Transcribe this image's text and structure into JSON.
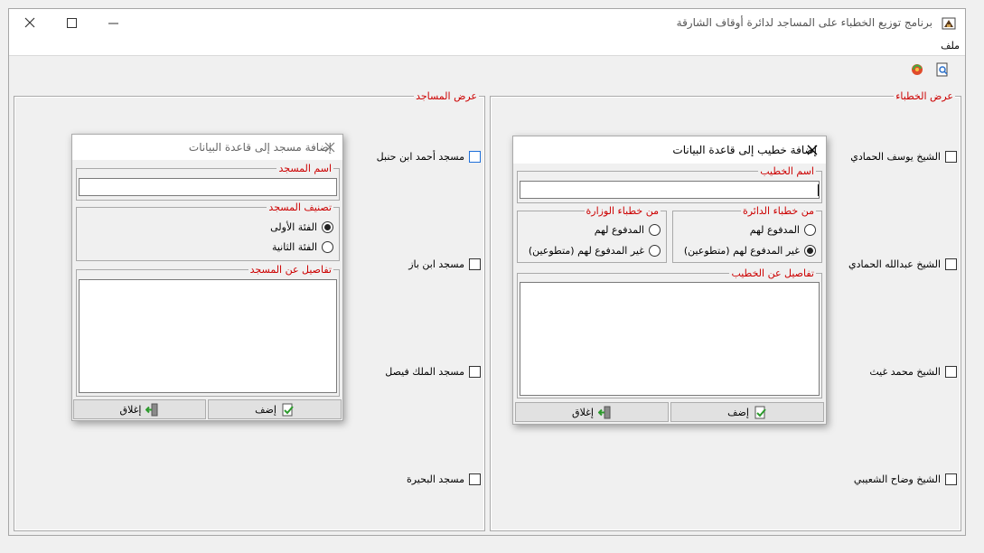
{
  "window": {
    "title": "برنامج توزيع الخطباء على المساجد لدائرة أوقاف الشارقة",
    "minimize": "—",
    "maximize": "☐",
    "close": "✕"
  },
  "menu": {
    "file": "ملف"
  },
  "preachers_panel": {
    "title": "عرض الخطباء",
    "items": [
      "الشيخ يوسف الحمادي",
      "الشيخ عبدالله الحمادي",
      "الشيخ محمد غيث",
      "الشيخ وضاح الشعيبي"
    ]
  },
  "mosques_panel": {
    "title": "عرض المساجد",
    "items": [
      "مسجد أحمد ابن حنبل",
      "مسجد ابن باز",
      "مسجد الملك فيصل",
      "مسجد البحيرة"
    ]
  },
  "add_preacher_dialog": {
    "title": "إضافة خطيب إلى قاعدة البيانات",
    "name_label": "اسم الخطيب",
    "dept_label": "من خطباء الدائرة",
    "dept_paid": "المدفوع لهم",
    "dept_unpaid": "غير المدفوع لهم (متطوعين)",
    "ministry_label": "من خطباء الوزارة",
    "ministry_paid": "المدفوع لهم",
    "ministry_unpaid": "غير المدفوع لهم (متطوعين)",
    "details_label": "تفاصيل عن الخطيب",
    "add_button": "إضف",
    "close_button": "إغلاق"
  },
  "add_mosque_dialog": {
    "title": "إضافة مسجد إلى قاعدة البيانات",
    "name_label": "اسم المسجد",
    "category_label": "تصنيف المسجد",
    "category_first": "الفئة الأولى",
    "category_second": "الفئة الثانية",
    "details_label": "تفاصيل عن المسجد",
    "add_button": "إضف",
    "close_button": "إغلاق"
  }
}
